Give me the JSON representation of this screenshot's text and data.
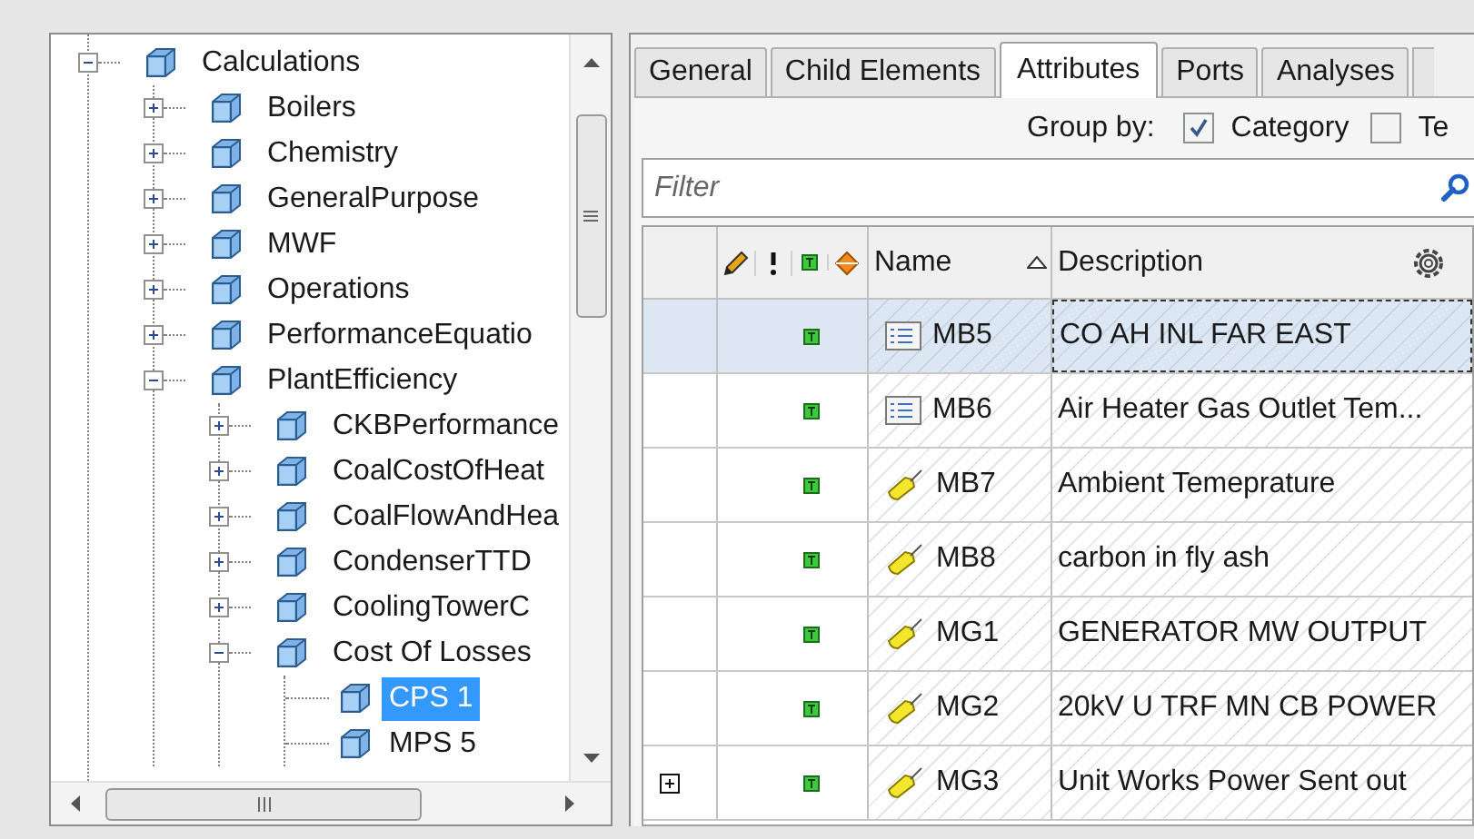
{
  "tree": [
    {
      "label": "Calculations",
      "kind": "folder",
      "expanded": true,
      "selected": false,
      "children": [
        {
          "label": "Boilers",
          "kind": "folder",
          "expanded": false,
          "selected": false
        },
        {
          "label": "Chemistry",
          "kind": "folder",
          "expanded": false,
          "selected": false
        },
        {
          "label": "GeneralPurpose",
          "kind": "folder",
          "expanded": false,
          "selected": false
        },
        {
          "label": "MWF",
          "kind": "folder",
          "expanded": false,
          "selected": false
        },
        {
          "label": "Operations",
          "kind": "folder",
          "expanded": false,
          "selected": false
        },
        {
          "label": "PerformanceEquatio",
          "kind": "folder",
          "expanded": false,
          "selected": false
        },
        {
          "label": "PlantEfficiency",
          "kind": "folder",
          "expanded": true,
          "selected": false,
          "children": [
            {
              "label": "CKBPerformance",
              "kind": "folder",
              "expanded": false,
              "selected": false
            },
            {
              "label": "CoalCostOfHeat",
              "kind": "folder",
              "expanded": false,
              "selected": false
            },
            {
              "label": "CoalFlowAndHea",
              "kind": "folder",
              "expanded": false,
              "selected": false
            },
            {
              "label": "CondenserTTD",
              "kind": "folder",
              "expanded": false,
              "selected": false
            },
            {
              "label": "CoolingTowerC",
              "kind": "folder",
              "expanded": false,
              "selected": false
            },
            {
              "label": "Cost Of Losses",
              "kind": "folder",
              "expanded": true,
              "selected": false,
              "children": [
                {
                  "label": "CPS 1",
                  "kind": "leaf",
                  "selected": true
                },
                {
                  "label": "MPS 5",
                  "kind": "leaf",
                  "selected": false
                }
              ]
            }
          ]
        }
      ]
    }
  ],
  "tabs": [
    {
      "label": "General",
      "selected": false
    },
    {
      "label": "Child Elements",
      "selected": false
    },
    {
      "label": "Attributes",
      "selected": true
    },
    {
      "label": "Ports",
      "selected": false
    },
    {
      "label": "Analyses",
      "selected": false
    }
  ],
  "group_by": {
    "label": "Group by:",
    "options": [
      {
        "label": "Category",
        "checked": true
      },
      {
        "label": "Te",
        "checked": false
      }
    ]
  },
  "filter": {
    "placeholder": "Filter"
  },
  "table": {
    "columns": [
      "Name",
      "Description"
    ],
    "rows": [
      {
        "kind": "list",
        "name": "MB5",
        "description": "CO AH INL FAR EAST",
        "selected": true,
        "expandable": false
      },
      {
        "kind": "list",
        "name": "MB6",
        "description": "Air Heater Gas Outlet Tem...",
        "selected": false,
        "expandable": false
      },
      {
        "kind": "tag",
        "name": "MB7",
        "description": "Ambient Temeprature",
        "selected": false,
        "expandable": false
      },
      {
        "kind": "tag",
        "name": "MB8",
        "description": "carbon in fly ash",
        "selected": false,
        "expandable": false
      },
      {
        "kind": "tag",
        "name": "MG1",
        "description": "GENERATOR MW OUTPUT",
        "selected": false,
        "expandable": false
      },
      {
        "kind": "tag",
        "name": "MG2",
        "description": "20kV U TRF MN CB POWER",
        "selected": false,
        "expandable": false
      },
      {
        "kind": "tag",
        "name": "MG3",
        "description": "Unit Works Power Sent out",
        "selected": false,
        "expandable": true
      }
    ]
  }
}
